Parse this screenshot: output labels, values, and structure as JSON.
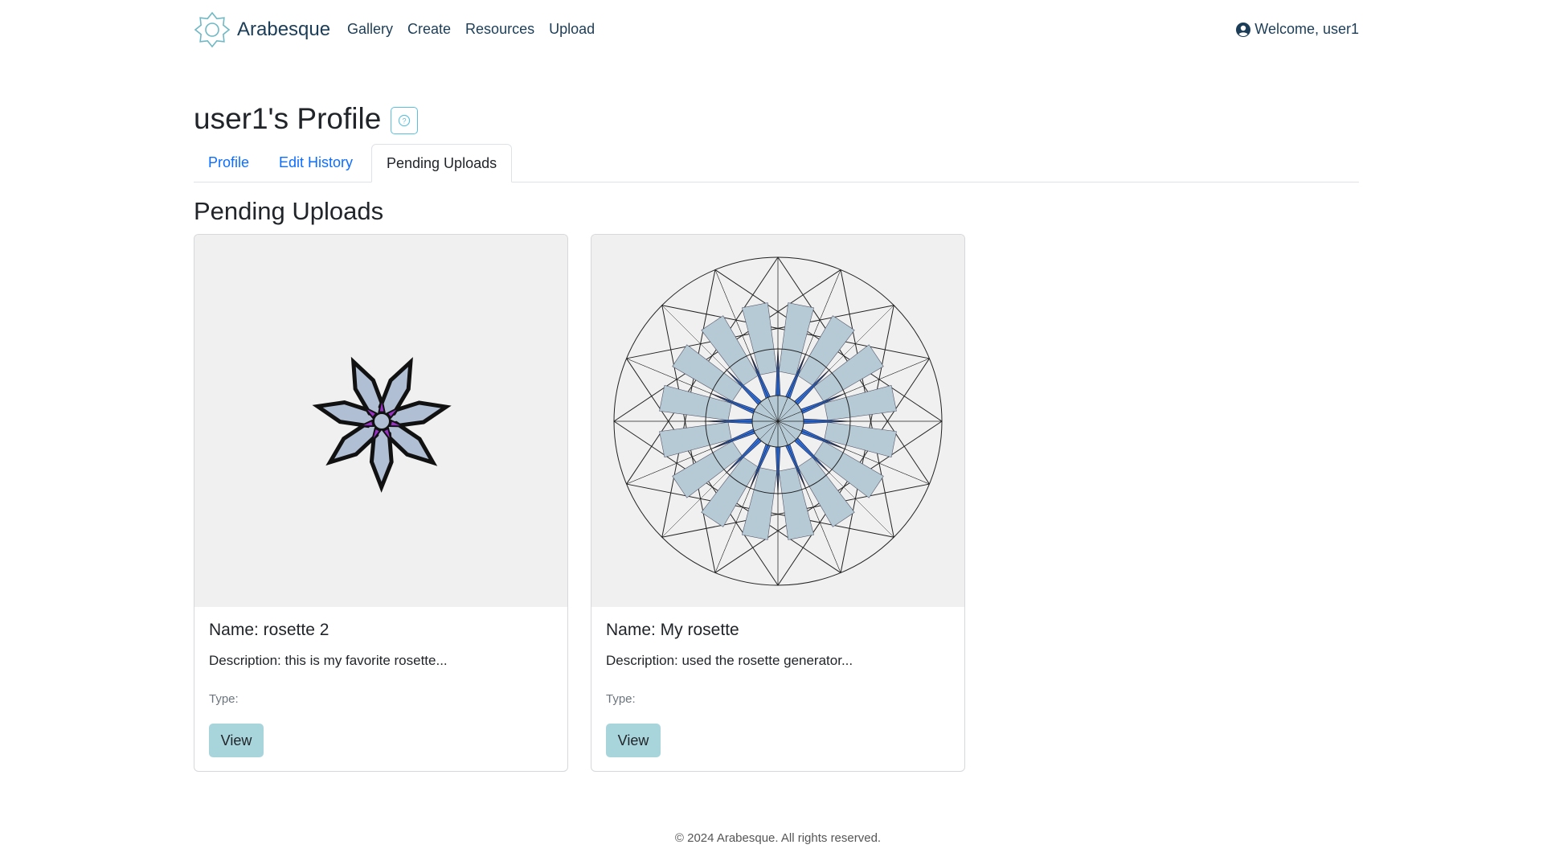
{
  "navbar": {
    "brand": "Arabesque",
    "links": [
      "Gallery",
      "Create",
      "Resources",
      "Upload"
    ],
    "welcome": "Welcome, user1"
  },
  "profile": {
    "title": "user1's Profile",
    "help_icon": "question-circle-icon"
  },
  "tabs": [
    {
      "label": "Profile",
      "active": false
    },
    {
      "label": "Edit History",
      "active": false
    },
    {
      "label": "Pending Uploads",
      "active": true
    }
  ],
  "pending": {
    "heading": "Pending Uploads",
    "cards": [
      {
        "name": "Name: rosette 2",
        "description": "Description: this is my favorite rosette...",
        "type": "Type:",
        "button": "View"
      },
      {
        "name": "Name: My rosette",
        "description": "Description: used the rosette generator...",
        "type": "Type:",
        "button": "View"
      }
    ]
  },
  "footer": "© 2024 Arabesque. All rights reserved.",
  "colors": {
    "link": "#0d6efd",
    "nav_text": "#1c3d57",
    "button_bg": "#a8d5db",
    "help_border": "#5bc0de",
    "rosette_fill": "#b0bfd4",
    "rosette_accent": "#9b30c8",
    "rosette_blue": "#2f6fde",
    "rosette_pale": "#b6cad6"
  }
}
